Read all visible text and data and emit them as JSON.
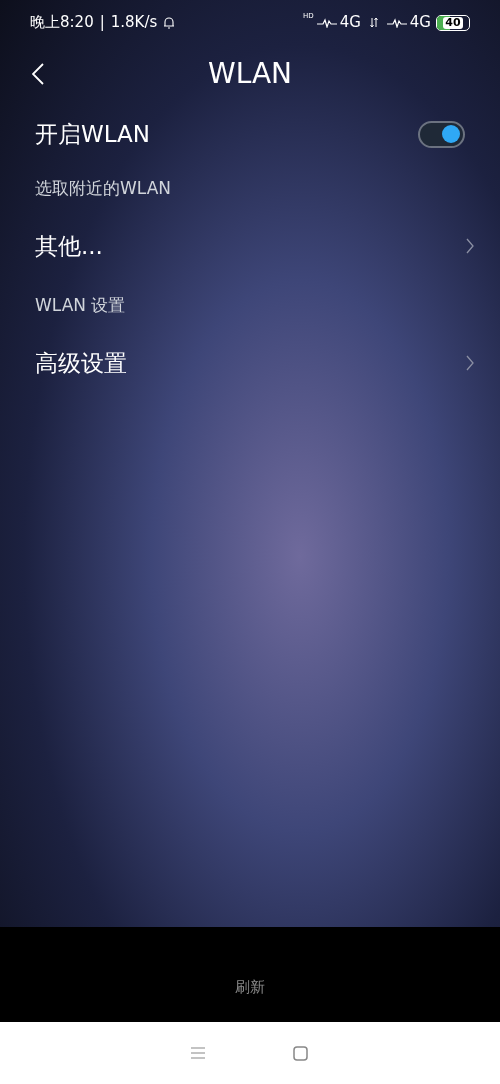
{
  "status_bar": {
    "time": "晚上8:20",
    "separator": "|",
    "speed": "1.8K/s",
    "hd": "HD",
    "network_1": "4G",
    "network_2": "4G",
    "battery": {
      "text": "40",
      "level": 0.4
    }
  },
  "header": {
    "title": "WLAN"
  },
  "items": [
    {
      "kind": "toggle",
      "label": "开启WLAN",
      "on": true
    },
    {
      "kind": "section",
      "label": "选取附近的WLAN"
    },
    {
      "kind": "link",
      "label": "其他..."
    },
    {
      "kind": "section",
      "label": "WLAN 设置"
    },
    {
      "kind": "link",
      "label": "高级设置"
    }
  ],
  "bottom_bar": {
    "button": "刷新"
  }
}
